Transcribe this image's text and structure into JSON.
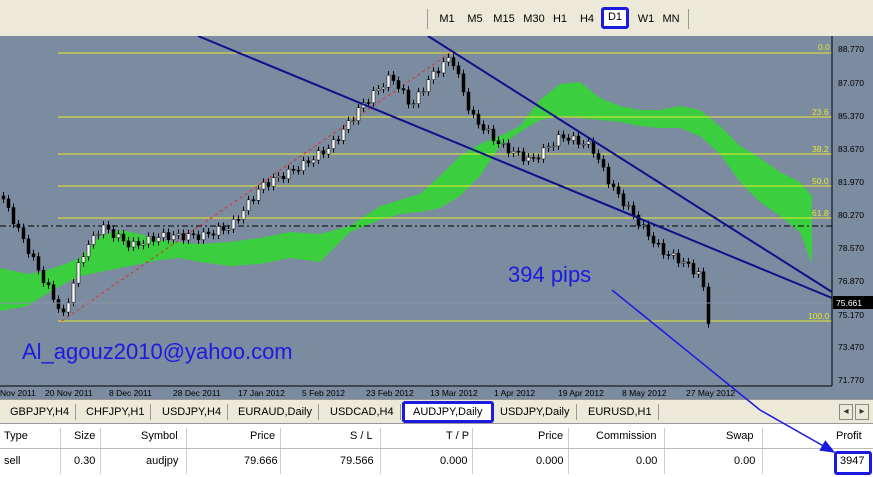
{
  "timeframes": [
    "M1",
    "M5",
    "M15",
    "M30",
    "H1",
    "H4",
    "D1",
    "W1",
    "MN"
  ],
  "selected_timeframe": "D1",
  "chart": {
    "price_axis": [
      "88.770",
      "87.070",
      "85.370",
      "83.670",
      "81.970",
      "80.270",
      "78.570",
      "76.870",
      "75.170",
      "73.470",
      "71.770"
    ],
    "current_price": "75.661",
    "date_axis": [
      "Nov 2011",
      "20 Nov 2011",
      "8 Dec 2011",
      "28 Dec 2011",
      "17 Jan 2012",
      "5 Feb 2012",
      "23 Feb 2012",
      "13 Mar 2012",
      "1 Apr 2012",
      "19 Apr 2012",
      "8 May 2012",
      "27 May 2012"
    ],
    "fib_levels": [
      "0.0",
      "23.6",
      "38.2",
      "50.0",
      "61.8",
      "100.0"
    ],
    "annotation_pips": "394 pips",
    "annotation_email": "Al_agouz2010@yahoo.com",
    "colors": {
      "background": "#7b8ba0",
      "cloud": "#34d534",
      "trendline": "#10108a",
      "fib": "#e8e830",
      "annotation": "#1a1ae0"
    }
  },
  "symbol_tabs": [
    "GBPJPY,H4",
    "CHFJPY,H1",
    "USDJPY,H4",
    "EURAUD,Daily",
    "USDCAD,H4",
    "AUDJPY,Daily",
    "USDJPY,Daily",
    "EURUSD,H1"
  ],
  "active_tab": "AUDJPY,Daily",
  "terminal": {
    "headers": [
      "Type",
      "Size",
      "Symbol",
      "Price",
      "S / L",
      "T / P",
      "Price",
      "Commission",
      "Swap",
      "Profit"
    ],
    "row": [
      "sell",
      "0.30",
      "audjpy",
      "79.666",
      "79.566",
      "0.000",
      "0.000",
      "0.00",
      "0.00",
      "3947"
    ]
  }
}
